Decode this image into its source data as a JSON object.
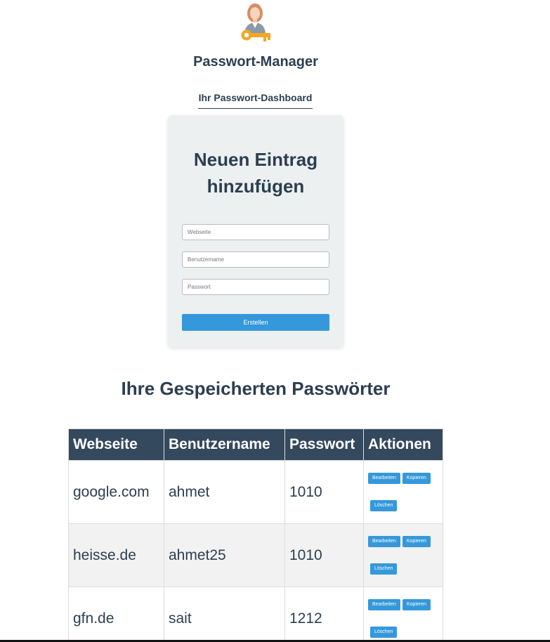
{
  "app": {
    "title": "Passwort-Manager",
    "dashboard_link": "Ihr Passwort-Dashboard",
    "logo_icon": "user-key-icon"
  },
  "form": {
    "title_line1": "Neuen Eintrag",
    "title_line2": "hinzufügen",
    "website_placeholder": "Webseite",
    "username_placeholder": "Benutzername",
    "password_placeholder": "Passwort",
    "website_value": "",
    "username_value": "",
    "password_value": "",
    "submit_label": "Erstellen"
  },
  "list": {
    "title": "Ihre Gespeicherten Passwörter",
    "headers": [
      "Webseite",
      "Benutzername",
      "Passwort",
      "Aktionen"
    ],
    "rows": [
      {
        "website": "google.com",
        "username": "ahmet",
        "password": "1010"
      },
      {
        "website": "heisse.de",
        "username": "ahmet25",
        "password": "1010"
      },
      {
        "website": "gfn.de",
        "username": "sait",
        "password": "1212"
      }
    ],
    "actions": {
      "edit_label": "Bearbeiten",
      "copy_label": "Kopieren",
      "delete_label": "Löschen"
    }
  },
  "colors": {
    "primary_text": "#2c3e50",
    "header_bg": "#34495e",
    "accent_button": "#3498db",
    "card_bg": "#ecf0f1",
    "key_color": "#f5a623"
  }
}
